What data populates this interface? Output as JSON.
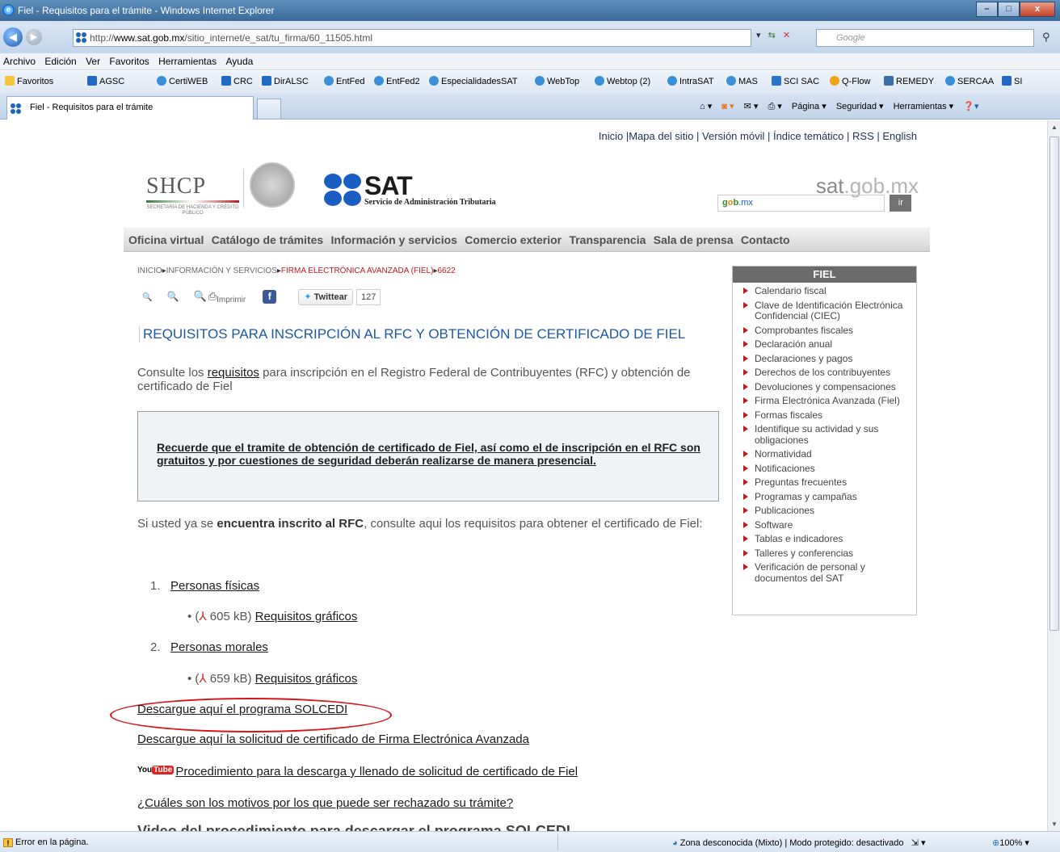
{
  "window": {
    "title": "Fiel - Requisitos para el trámite - Windows Internet Explorer",
    "buttons": [
      "–",
      "□",
      "x"
    ]
  },
  "address_bar": {
    "url_prefix": "http://",
    "url_host": "www.sat.gob.mx",
    "url_path": "/sitio_internet/e_sat/tu_firma/60_11505.html",
    "search_placeholder": "Google"
  },
  "menu": [
    "Archivo",
    "Edición",
    "Ver",
    "Favoritos",
    "Herramientas",
    "Ayuda"
  ],
  "favorites_bar": {
    "label": "Favoritos",
    "items": [
      {
        "label": "AGSC",
        "icon": "sat-icon"
      },
      {
        "label": "CertiWEB",
        "icon": "ie-icon"
      },
      {
        "label": "CRC",
        "icon": "sat-icon"
      },
      {
        "label": "DirALSC",
        "icon": "sat-icon"
      },
      {
        "label": "EntFed",
        "icon": "ie-icon"
      },
      {
        "label": "EntFed2",
        "icon": "ie-icon"
      },
      {
        "label": "EspecialidadesSAT",
        "icon": "ie-icon"
      },
      {
        "label": "WebTop",
        "icon": "ie-icon"
      },
      {
        "label": "Webtop (2)",
        "icon": "ie-icon"
      },
      {
        "label": "IntraSAT",
        "icon": "ie-icon"
      },
      {
        "label": "MAS",
        "icon": "ie-icon"
      },
      {
        "label": "SCI SAC",
        "icon": "flag-icon"
      },
      {
        "label": "Q-Flow",
        "icon": "q-icon"
      },
      {
        "label": "REMEDY",
        "icon": "remedy-icon"
      },
      {
        "label": "SERCAA",
        "icon": "ie-icon"
      },
      {
        "label": "SI",
        "icon": "sat-icon"
      }
    ]
  },
  "tab": {
    "label": "Fiel - Requisitos para el trámite"
  },
  "command_bar": {
    "pagina": "Página ▾",
    "seguridad": "Seguridad ▾",
    "herramientas": "Herramientas ▾"
  },
  "page": {
    "top_links": [
      "Inicio",
      "Mapa del sitio",
      "Versión móvil",
      "Índice temático",
      "RSS",
      "English"
    ],
    "shcp_big": "SHCP",
    "shcp_small": "SECRETARÍA DE HACIENDA Y CRÉDITO PÚBLICO",
    "sat_word": "SAT",
    "sat_subtitle": "Servicio de Administración Tributaria",
    "domain_prefix": "sat",
    "domain_suffix": ".gob.mx",
    "search_g": "g",
    "search_o": "o",
    "search_b": "b",
    "search_mx": ".mx",
    "search_button": "ir",
    "nav": [
      "Oficina virtual",
      "Catálogo de trámites",
      "Información y servicios",
      "Comercio exterior",
      "Transparencia",
      "Sala de prensa",
      "Contacto"
    ],
    "breadcrumb": {
      "a": "INICIO",
      "b": "INFORMACIÓN Y SERVICIOS",
      "c": "FIRMA ELECTRÓNICA AVANZADA (FIEL)",
      "d": "6622"
    },
    "tools": {
      "imprimir": "Imprimir",
      "tweet": "Twittear",
      "tweet_count": "127"
    },
    "title": "REQUISITOS PARA INSCRIPCIÓN AL RFC Y OBTENCIÓN DE CERTIFICADO DE FIEL",
    "intro_pre": "Consulte los ",
    "intro_link": "requisitos",
    "intro_post": " para inscripción en el Registro Federal de Contribuyentes (RFC) y obtención de certificado de Fiel",
    "notice": "Recuerde que el tramite de obtención de certificado de Fiel, así como el de inscripción en el RFC son gratuitos y por cuestiones de seguridad deberán realizarse de manera presencial.",
    "inscrito_pre": "Si usted ya se ",
    "inscrito_bold": "encuentra inscrito al RFC",
    "inscrito_post": ", consulte aqui los requisitos para obtener el certificado de Fiel:",
    "list": [
      {
        "num": "1.",
        "label": "Personas físicas",
        "size": "605 kB)",
        "doc": "Requisitos gráficos"
      },
      {
        "num": "2.",
        "label": "Personas morales",
        "size": "659 kB)",
        "doc": "Requisitos gráficos"
      }
    ],
    "link_solcedi": "Descargue aquí el programa SOLCEDI",
    "link_solicitud": "Descargue aquí la solicitud de certificado de Firma Electrónica Avanzada",
    "youtube_you": "You",
    "youtube_tube": "Tube",
    "link_procedimiento": "Procedimiento para la descarga y llenado de solicitud de certificado de Fiel",
    "link_motivos": "¿Cuáles son los motivos por los que puede ser rechazado su trámite?",
    "link_video": "Video del procedimiento para descargar el programa SOLCEDI"
  },
  "sidebar": {
    "title": "FIEL",
    "items": [
      "Calendario fiscal",
      "Clave de Identificación Electrónica Confidencial (CIEC)",
      "Comprobantes fiscales",
      "Declaración anual",
      "Declaraciones y pagos",
      "Derechos de los contribuyentes",
      "Devoluciones y compensaciones",
      "Firma Electrónica Avanzada (Fiel)",
      "Formas fiscales",
      "Identifique su actividad y sus obligaciones",
      "Normatividad",
      "Notificaciones",
      "Preguntas frecuentes",
      "Programas y campañas",
      "Publicaciones",
      "Software",
      "Tablas e indicadores",
      "Talleres y conferencias",
      "Verificación de personal y documentos del SAT"
    ]
  },
  "status_bar": {
    "error": "Error en la página.",
    "zone": "Zona desconocida (Mixto) | Modo protegido: desactivado",
    "zoom": "100%"
  },
  "colors": {
    "title_blue": "#1e57a8",
    "breadcrumb_red": "#c0191e",
    "highlight_ellipse": "#d4161b",
    "sat_blue": "#1b5ec3"
  }
}
